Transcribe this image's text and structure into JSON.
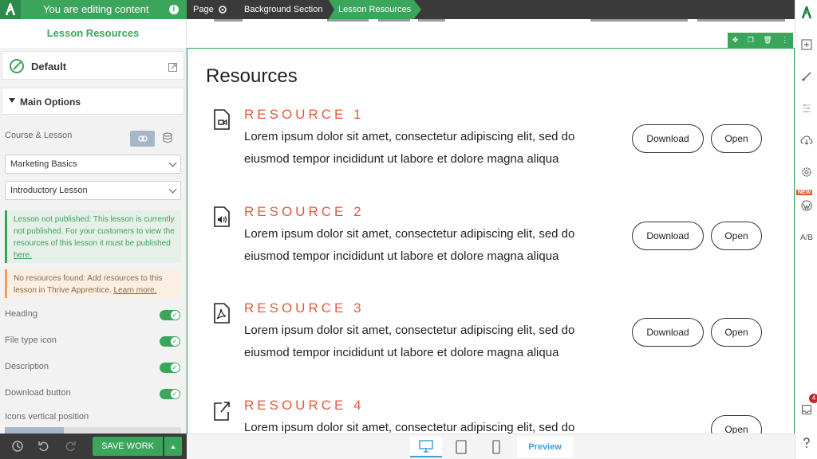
{
  "editing_bar": {
    "text": "You are editing content",
    "info_label": "i"
  },
  "breadcrumbs": {
    "page": "Page",
    "background": "Background Section",
    "active": "Lesson Resources"
  },
  "sidebar": {
    "title": "Lesson Resources",
    "style_label": "Default",
    "main_options_label": "Main Options",
    "course_lesson_label": "Course & Lesson",
    "course_select": "Marketing Basics",
    "lesson_select": "Introductory Lesson",
    "notice_unpublished": "Lesson not published: This lesson is currently not published. For your customers to view the resources of this lesson it must be published ",
    "notice_unpublished_link": "here.",
    "notice_no_resources": "No resources found: Add resources to this lesson in Thrive Apprentice. ",
    "notice_no_resources_link": "Learn more.",
    "toggles": [
      {
        "label": "Heading",
        "on": true
      },
      {
        "label": "File type icon",
        "on": true
      },
      {
        "label": "Description",
        "on": true
      },
      {
        "label": "Download button",
        "on": true
      }
    ],
    "icons_vertical_label": "Icons vertical position"
  },
  "footer": {
    "save_label": "SAVE WORK",
    "preview_label": "Preview"
  },
  "right_bar": {
    "new_badge": "NEW",
    "notification_count": "4",
    "ab_label": "A/B"
  },
  "content": {
    "heading": "Resources",
    "resources": [
      {
        "title": "RESOURCE 1",
        "icon": "video-file-icon",
        "desc": "Lorem ipsum dolor sit amet, consectetur adipiscing elit, sed do eiusmod tempor incididunt ut labore et dolore magna aliqua",
        "download": "Download",
        "open": "Open"
      },
      {
        "title": "RESOURCE 2",
        "icon": "audio-file-icon",
        "desc": "Lorem ipsum dolor sit amet, consectetur adipiscing elit, sed do eiusmod tempor incididunt ut labore et dolore magna aliqua",
        "download": "Download",
        "open": "Open"
      },
      {
        "title": "RESOURCE 3",
        "icon": "pdf-file-icon",
        "desc": "Lorem ipsum dolor sit amet, consectetur adipiscing elit, sed do eiusmod tempor incididunt ut labore et dolore magna aliqua",
        "download": "Download",
        "open": "Open"
      },
      {
        "title": "RESOURCE 4",
        "icon": "external-link-icon",
        "desc": "Lorem ipsum dolor sit amet, consectetur adipiscing elit, sed do",
        "open": "Open"
      }
    ]
  },
  "colors": {
    "accent_green": "#3ba55c",
    "resource_title": "#e45a3e",
    "dark_bar": "#3a3a3a",
    "preview_blue": "#3aa0d8"
  }
}
